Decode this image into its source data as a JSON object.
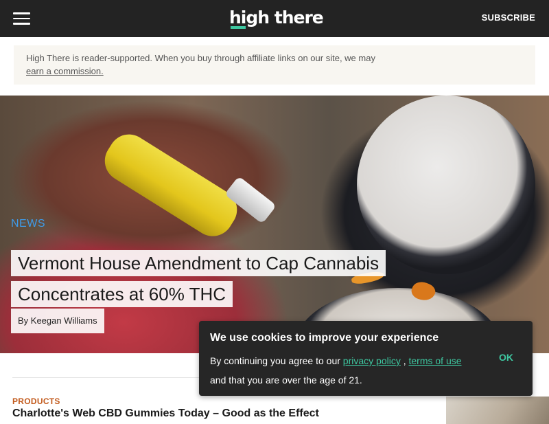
{
  "header": {
    "menu_icon": "hamburger-icon",
    "logo_text": "high there",
    "subscribe_label": "SUBSCRIBE"
  },
  "disclaimer": {
    "text": "High There is reader-supported. When you buy through affiliate links on our site, we may",
    "link": "earn a commission."
  },
  "hero": {
    "category": "NEWS",
    "title_line1": "Vermont House Amendment to Cap Cannabis",
    "title_line2": "Concentrates at 60% THC",
    "byline": "By Keegan Williams"
  },
  "next_article": {
    "category": "PRODUCTS",
    "title": "Charlotte's Web CBD Gummies Today – Good as the Effect"
  },
  "cookie_banner": {
    "title": "We use cookies to improve your experience",
    "text_before": "By continuing you agree to our ",
    "privacy_link": "privacy policy",
    "separator": " , ",
    "terms_link": "terms of use",
    "text_after": "and that you are over the age of 21.",
    "ok_label": "OK"
  },
  "colors": {
    "header_bg": "#232323",
    "accent": "#3ec7a0",
    "category_blue": "#3f9be8",
    "products_orange": "#c25a1c",
    "cookie_bg": "#262626"
  }
}
